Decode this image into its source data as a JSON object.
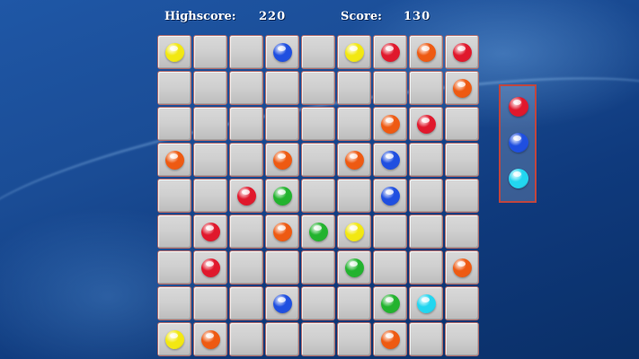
{
  "header": {
    "highscore_label": "Highscore:",
    "highscore_value": "220",
    "score_label": "Score:",
    "score_value": "130"
  },
  "colors": {
    "Y": "#f2e812",
    "B": "#1f4fe0",
    "R": "#e0182c",
    "O": "#ee5a12",
    "G": "#22b32e",
    "C": "#22d6f0"
  },
  "board": [
    [
      "Y",
      "",
      "",
      "B",
      "",
      "Y",
      "R",
      "O",
      "R"
    ],
    [
      "",
      "",
      "",
      "",
      "",
      "",
      "",
      "",
      "O"
    ],
    [
      "",
      "",
      "",
      "",
      "",
      "",
      "O",
      "R",
      ""
    ],
    [
      "O",
      "",
      "",
      "O",
      "",
      "O",
      "B",
      "",
      ""
    ],
    [
      "",
      "",
      "R",
      "G",
      "",
      "",
      "B",
      "",
      ""
    ],
    [
      "",
      "R",
      "",
      "O",
      "G",
      "Y",
      "",
      "",
      ""
    ],
    [
      "",
      "R",
      "",
      "",
      "",
      "G",
      "",
      "",
      "O"
    ],
    [
      "",
      "",
      "",
      "B",
      "",
      "",
      "G",
      "C",
      ""
    ],
    [
      "Y",
      "O",
      "",
      "",
      "",
      "",
      "O",
      "",
      ""
    ]
  ],
  "next_balls": [
    "R",
    "B",
    "C"
  ]
}
